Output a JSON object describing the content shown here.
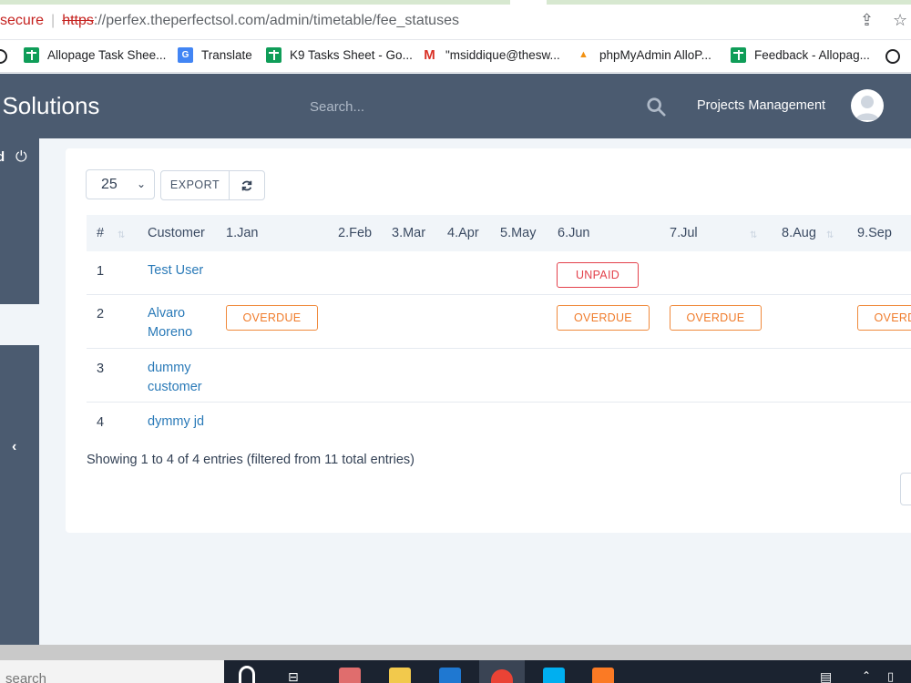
{
  "browser": {
    "secure_label": "secure",
    "url_scheme": "https",
    "url_rest": "://perfex.theperfectsol.com/admin/timetable/fee_statuses",
    "bookmarks": [
      {
        "label": "Allopage Task Shee...",
        "icon": "sheets-icon"
      },
      {
        "label": "Translate",
        "icon": "translate-icon"
      },
      {
        "label": "K9 Tasks Sheet - Go...",
        "icon": "sheets-icon"
      },
      {
        "label": "\"msiddique@thesw...",
        "icon": "gmail-icon"
      },
      {
        "label": "phpMyAdmin AlloP...",
        "icon": "phpmyadmin-icon"
      },
      {
        "label": "Feedback - Allopag...",
        "icon": "sheets-icon"
      }
    ]
  },
  "header": {
    "brand": "t Solutions",
    "search_placeholder": "Search...",
    "projects_link": "Projects Management"
  },
  "sidebar": {
    "top_label": "d"
  },
  "toolbar": {
    "page_size": "25",
    "export_label": "EXPORT"
  },
  "table": {
    "columns": [
      "#",
      "Customer",
      "1.Jan",
      "2.Feb",
      "3.Mar",
      "4.Apr",
      "5.May",
      "6.Jun",
      "7.Jul",
      "8.Aug",
      "9.Sep"
    ],
    "rows": [
      {
        "num": "1",
        "customer": "Test User",
        "statuses": {
          "6.Jun": "UNPAID"
        }
      },
      {
        "num": "2",
        "customer": "Alvaro Moreno",
        "statuses": {
          "1.Jan": "OVERDUE",
          "6.Jun": "OVERDUE",
          "7.Jul": "OVERDUE",
          "9.Sep": "OVERDUE"
        }
      },
      {
        "num": "3",
        "customer": "dummy customer",
        "statuses": {}
      },
      {
        "num": "4",
        "customer": "dymmy jd",
        "statuses": {}
      }
    ],
    "info": "Showing 1 to 4 of 4 entries (filtered from 11 total entries)"
  },
  "taskbar": {
    "search_placeholder": "search"
  },
  "colors": {
    "header_bg": "#4b5b70",
    "link": "#2a7ab8",
    "unpaid": "#e3414b",
    "overdue": "#f07b2a"
  }
}
